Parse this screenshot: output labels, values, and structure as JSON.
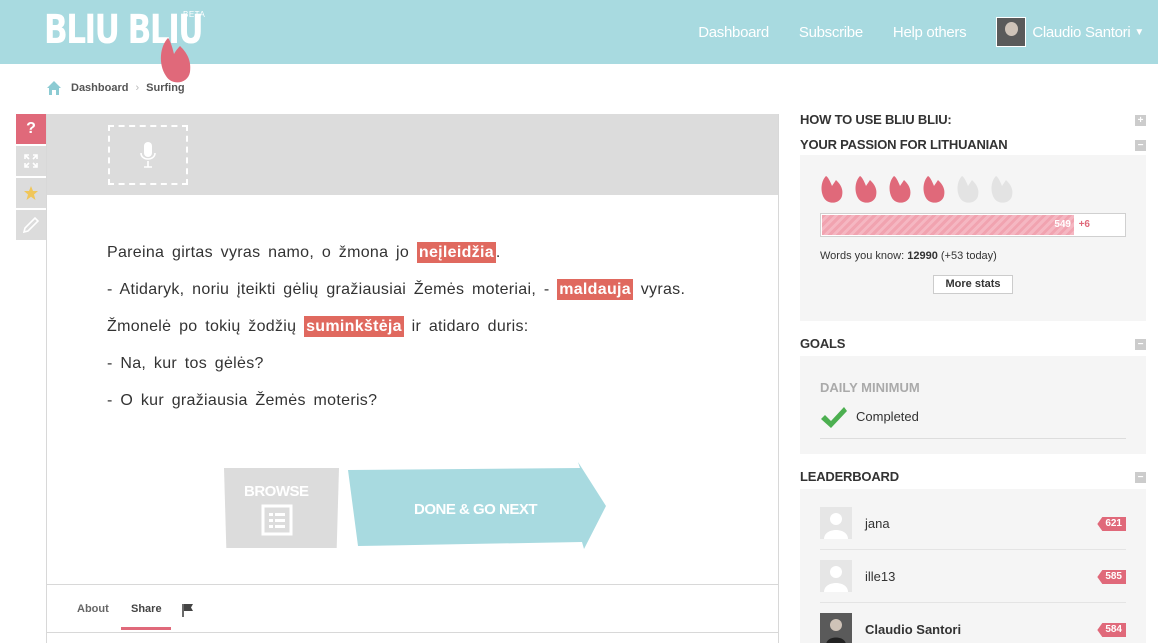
{
  "header": {
    "logo": "BLIU BLIU",
    "beta": "BETA",
    "nav": [
      "Dashboard",
      "Subscribe",
      "Help others"
    ],
    "user_name": "Claudio Santori",
    "brand_color": "#a8dae0"
  },
  "breadcrumb": {
    "home_icon": "home-icon",
    "items": [
      "Dashboard",
      "Surfing"
    ]
  },
  "tools": {
    "help_label": "?",
    "icons": [
      "help-icon",
      "fullscreen-icon",
      "star-icon",
      "pencil-icon"
    ]
  },
  "text": {
    "lines": [
      [
        "Pareina girtas vyras namo, o žmona jo ",
        "neįleidžia",
        "."
      ],
      [
        "- Atidaryk, noriu įteikti gėlių gražiausiai Žemės moteriai, - ",
        "maldauja",
        " vyras."
      ],
      [
        "Žmonelė po tokių žodžių ",
        "suminkštėja",
        " ir atidaro duris:"
      ],
      [
        "- Na, kur tos gėlės?"
      ],
      [
        "- O kur gražiausia Žemės moteris?"
      ]
    ],
    "highlight_color": "#e0695f"
  },
  "actions": {
    "browse": "BROWSE",
    "done": "DONE & GO NEXT"
  },
  "tabs": {
    "about": "About",
    "share": "Share",
    "flag_icon": "flag-icon"
  },
  "sidebar": {
    "how_to": "HOW TO USE BLIU BLIU:",
    "passion": {
      "title": "YOUR PASSION FOR LITHUANIAN",
      "tongues_filled": 4,
      "tongues_total": 6,
      "progress_value": "549",
      "progress_fraction": 0.83,
      "progress_delta": "+6",
      "words_label": "Words you know:",
      "words_value": "12990",
      "words_today": "(+53 today)",
      "more_stats": "More stats"
    },
    "goals": {
      "title": "GOALS",
      "label": "DAILY MINIMUM",
      "status": "Completed"
    },
    "leaderboard": {
      "title": "LEADERBOARD",
      "rows": [
        {
          "name": "jana",
          "score": "621",
          "me": false
        },
        {
          "name": "ille13",
          "score": "585",
          "me": false
        },
        {
          "name": "Claudio Santori",
          "score": "584",
          "me": true
        }
      ]
    },
    "toggle_expand": "+",
    "toggle_collapse": "−"
  }
}
